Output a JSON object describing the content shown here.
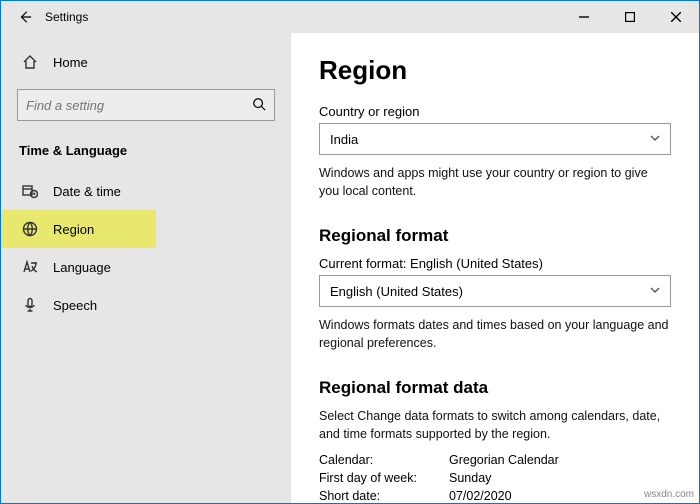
{
  "titlebar": {
    "title": "Settings"
  },
  "sidebar": {
    "home_label": "Home",
    "search_placeholder": "Find a setting",
    "section_label": "Time & Language",
    "items": [
      {
        "label": "Date & time"
      },
      {
        "label": "Region"
      },
      {
        "label": "Language"
      },
      {
        "label": "Speech"
      }
    ]
  },
  "main": {
    "heading": "Region",
    "country_label": "Country or region",
    "country_value": "India",
    "country_desc": "Windows and apps might use your country or region to give you local content.",
    "rf_heading": "Regional format",
    "rf_current_label": "Current format: English (United States)",
    "rf_value": "English (United States)",
    "rf_desc": "Windows formats dates and times based on your language and regional preferences.",
    "rfd_heading": "Regional format data",
    "rfd_desc": "Select Change data formats to switch among calendars, date, and time formats supported by the region.",
    "rows": [
      {
        "k": "Calendar:",
        "v": "Gregorian Calendar"
      },
      {
        "k": "First day of week:",
        "v": "Sunday"
      },
      {
        "k": "Short date:",
        "v": "07/02/2020"
      }
    ]
  },
  "watermark": "wsxdn.com"
}
